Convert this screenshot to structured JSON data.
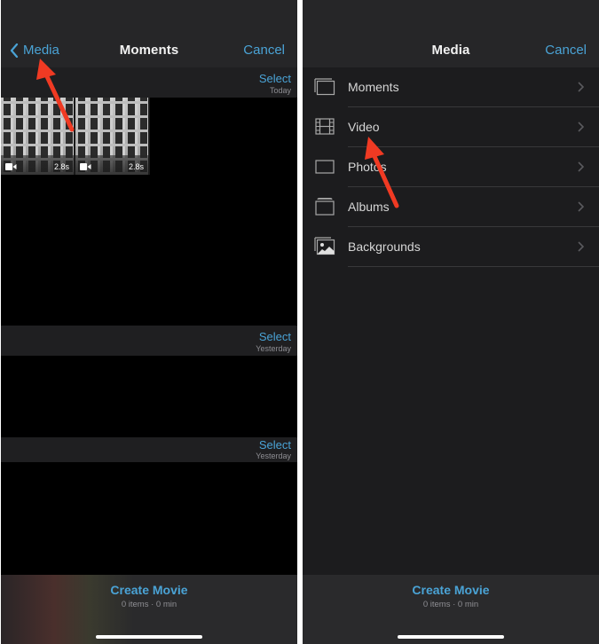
{
  "left_screen": {
    "nav": {
      "back_label": "Media",
      "title": "Moments",
      "cancel_label": "Cancel"
    },
    "sections": [
      {
        "select_label": "Select",
        "date": "Today",
        "thumbnails": [
          {
            "type": "video",
            "duration": "2.8s"
          },
          {
            "type": "video",
            "duration": "2.8s"
          }
        ]
      },
      {
        "select_label": "Select",
        "date": "Yesterday"
      },
      {
        "select_label": "Select",
        "date": "Yesterday"
      }
    ],
    "footer": {
      "create_label": "Create Movie",
      "summary": "0 items · 0 min"
    }
  },
  "right_screen": {
    "nav": {
      "title": "Media",
      "cancel_label": "Cancel"
    },
    "items": [
      {
        "label": "Moments",
        "icon": "moments-icon"
      },
      {
        "label": "Video",
        "icon": "film-icon"
      },
      {
        "label": "Photos",
        "icon": "photo-frame-icon"
      },
      {
        "label": "Albums",
        "icon": "album-stack-icon"
      },
      {
        "label": "Backgrounds",
        "icon": "landscape-icon"
      }
    ],
    "footer": {
      "create_label": "Create Movie",
      "summary": "0 items · 0 min"
    }
  },
  "colors": {
    "accent": "#4aa3d6",
    "annotation_arrow": "#f03a23",
    "nav_bg": "#262628",
    "list_bg": "#1c1c1e"
  }
}
